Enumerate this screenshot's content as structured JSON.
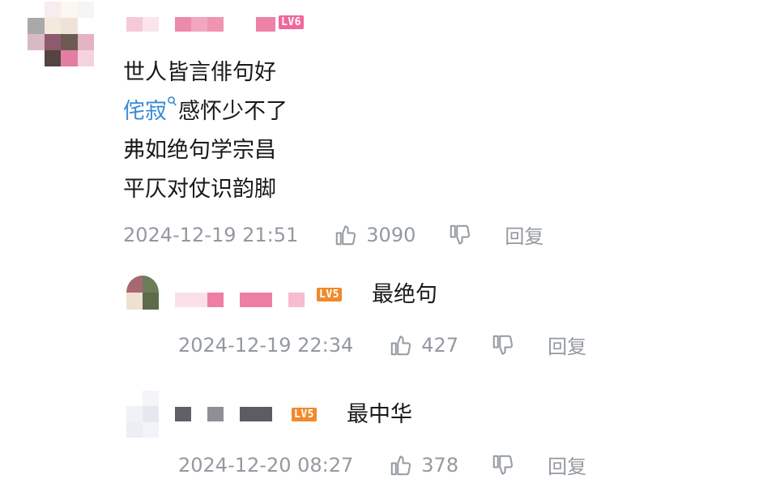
{
  "comment": {
    "level_badge": "LV6",
    "content_lines": [
      "世人皆言俳句好",
      "感怀少不了",
      "弗如绝句学宗昌",
      "平仄对仗识韵脚"
    ],
    "keyword": "侘寂",
    "keyword_icon": "search-icon",
    "time": "2024-12-19 21:51",
    "likes": "3090",
    "reply_label": "回复"
  },
  "replies": [
    {
      "level_badge": "LV5",
      "text": "最绝句",
      "time": "2024-12-19 22:34",
      "likes": "427",
      "reply_label": "回复"
    },
    {
      "level_badge": "LV5",
      "text": "最中华",
      "time": "2024-12-20 08:27",
      "likes": "378",
      "reply_label": "回复"
    }
  ],
  "colors": {
    "keyword": "#3a8ad6",
    "meta": "#9499a0",
    "lv6": "#f0689a",
    "lv5": "#f08a2c"
  }
}
